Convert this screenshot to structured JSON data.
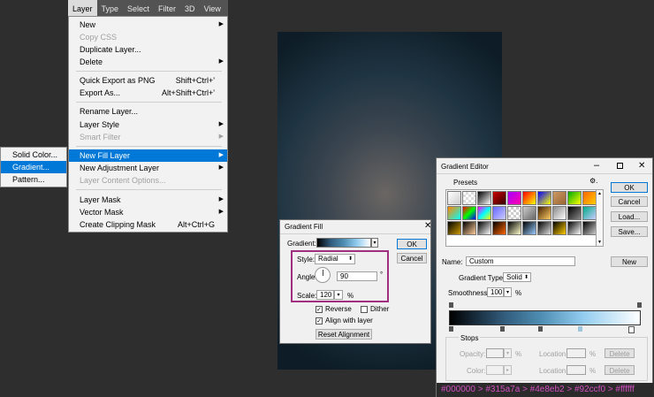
{
  "menubar": {
    "items": [
      "Layer",
      "Type",
      "Select",
      "Filter",
      "3D",
      "View"
    ]
  },
  "layer_menu": {
    "items": [
      {
        "label": "New",
        "shortcut": "",
        "submenu": true,
        "disabled": false
      },
      {
        "label": "Copy CSS",
        "shortcut": "",
        "submenu": false,
        "disabled": true
      },
      {
        "label": "Duplicate Layer...",
        "shortcut": "",
        "submenu": false,
        "disabled": false
      },
      {
        "label": "Delete",
        "shortcut": "",
        "submenu": true,
        "disabled": false
      },
      {
        "label": "Quick Export as PNG",
        "shortcut": "Shift+Ctrl+'",
        "submenu": false,
        "disabled": false
      },
      {
        "label": "Export As...",
        "shortcut": "Alt+Shift+Ctrl+'",
        "submenu": false,
        "disabled": false
      },
      {
        "label": "Rename Layer...",
        "shortcut": "",
        "submenu": false,
        "disabled": false
      },
      {
        "label": "Layer Style",
        "shortcut": "",
        "submenu": true,
        "disabled": false
      },
      {
        "label": "Smart Filter",
        "shortcut": "",
        "submenu": true,
        "disabled": true
      },
      {
        "label": "New Fill Layer",
        "shortcut": "",
        "submenu": true,
        "disabled": false
      },
      {
        "label": "New Adjustment Layer",
        "shortcut": "",
        "submenu": true,
        "disabled": false
      },
      {
        "label": "Layer Content Options...",
        "shortcut": "",
        "submenu": false,
        "disabled": true
      },
      {
        "label": "Layer Mask",
        "shortcut": "",
        "submenu": true,
        "disabled": false
      },
      {
        "label": "Vector Mask",
        "shortcut": "",
        "submenu": true,
        "disabled": false
      },
      {
        "label": "Create Clipping Mask",
        "shortcut": "Alt+Ctrl+G",
        "submenu": false,
        "disabled": false
      }
    ],
    "highlighted": "New Fill Layer"
  },
  "fill_submenu": {
    "items": [
      "Solid Color...",
      "Gradient...",
      "Pattern..."
    ],
    "highlighted": "Gradient..."
  },
  "gradient_fill": {
    "title": "Gradient Fill",
    "gradient_label": "Gradient:",
    "style_label": "Style:",
    "style_value": "Radial",
    "angle_label": "Angle:",
    "angle_value": "90",
    "angle_unit": "°",
    "scale_label": "Scale:",
    "scale_value": "120",
    "scale_unit": "%",
    "reverse_label": "Reverse",
    "reverse_checked": true,
    "dither_label": "Dither",
    "dither_checked": false,
    "align_label": "Align with layer",
    "align_checked": true,
    "reset_label": "Reset Alignment",
    "ok_label": "OK",
    "cancel_label": "Cancel",
    "highlight_color": "#a0307f"
  },
  "gradient_editor": {
    "title": "Gradient Editor",
    "presets_label": "Presets",
    "ok_label": "OK",
    "cancel_label": "Cancel",
    "load_label": "Load...",
    "save_label": "Save...",
    "name_label": "Name:",
    "name_value": "Custom",
    "new_label": "New",
    "gradient_type_label": "Gradient Type:",
    "gradient_type_value": "Solid",
    "smoothness_label": "Smoothness:",
    "smoothness_value": "100",
    "smoothness_unit": "%",
    "stops_label": "Stops",
    "opacity_label": "Opacity:",
    "color_label": "Color:",
    "location_label": "Location:",
    "percent": "%",
    "delete_label": "Delete",
    "stop_colors": [
      "#000000",
      "#315a7a",
      "#4e8eb2",
      "#92ccf0",
      "#ffffff"
    ],
    "hex_caption": "#000000 > #315a7a > #4e8eb2 > #92ccf0 > #ffffff"
  }
}
